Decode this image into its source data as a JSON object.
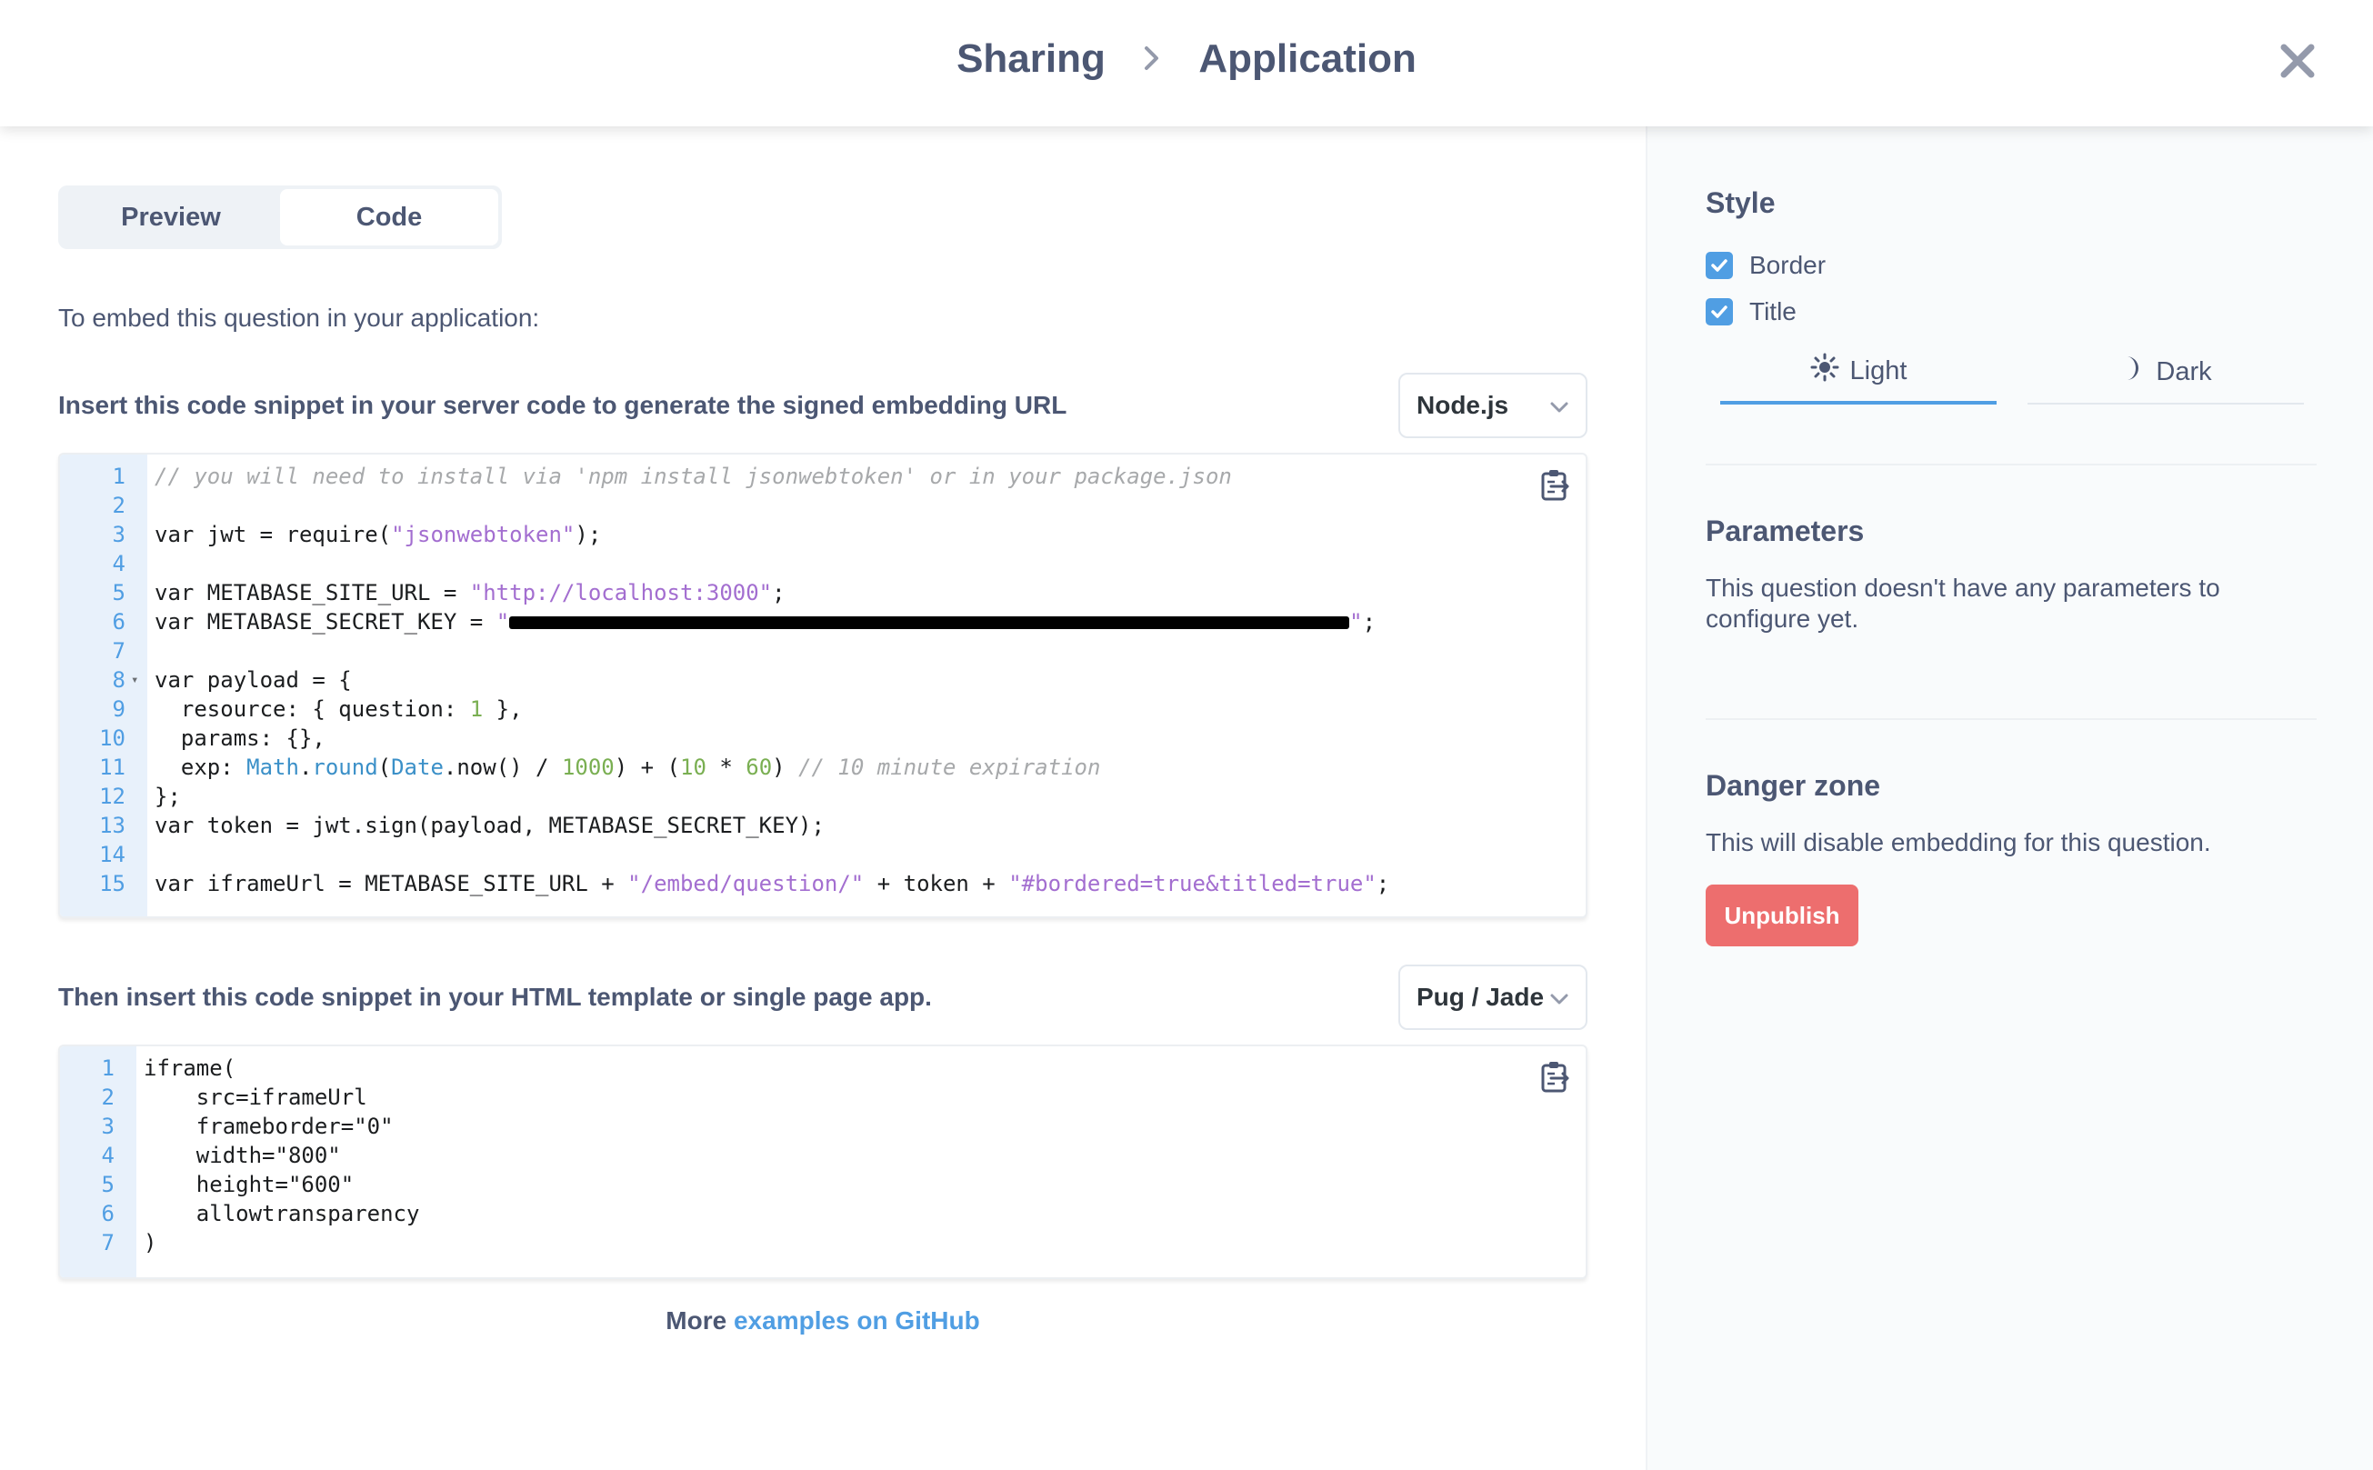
{
  "header": {
    "breadcrumb": [
      "Sharing",
      "Application"
    ]
  },
  "tabs": [
    {
      "label": "Preview",
      "active": false
    },
    {
      "label": "Code",
      "active": true
    }
  ],
  "intro_text": "To embed this question in your application:",
  "server_snippet": {
    "label": "Insert this code snippet in your server code to generate the signed embedding URL",
    "language": "Node.js",
    "line_numbers": [
      "1",
      "2",
      "3",
      "4",
      "5",
      "6",
      "7",
      "8",
      "9",
      "10",
      "11",
      "12",
      "13",
      "14",
      "15"
    ]
  },
  "html_snippet": {
    "label": "Then insert this code snippet in your HTML template or single page app.",
    "language": "Pug / Jade",
    "line_numbers": [
      "1",
      "2",
      "3",
      "4",
      "5",
      "6",
      "7"
    ]
  },
  "code_text": {
    "s_l1": "// you will need to install via 'npm install jsonwebtoken' or in your package.json",
    "s_l3a": "var jwt = require(",
    "s_l3b": "\"jsonwebtoken\"",
    "s_l3c": ");",
    "s_l5a": "var METABASE_SITE_URL = ",
    "s_l5b": "\"http://localhost:3000\"",
    "s_l5c": ";",
    "s_l6a": "var METABASE_SECRET_KEY = ",
    "s_l6b": "\"",
    "s_l6c": "\"",
    "s_l6d": ";",
    "s_l8": "var payload = {",
    "s_l9a": "  resource: { question: ",
    "s_l9b": "1",
    "s_l9c": " },",
    "s_l10": "  params: {},",
    "s_l11a": "  exp: ",
    "s_l11b": "Math",
    "s_l11c": ".",
    "s_l11d": "round",
    "s_l11e": "(",
    "s_l11f": "Date",
    "s_l11g": ".now() / ",
    "s_l11h": "1000",
    "s_l11i": ") + (",
    "s_l11j": "10",
    "s_l11k": " * ",
    "s_l11l": "60",
    "s_l11m": ") ",
    "s_l11n": "// 10 minute expiration",
    "s_l12": "};",
    "s_l13": "var token = jwt.sign(payload, METABASE_SECRET_KEY);",
    "s_l15a": "var iframeUrl = METABASE_SITE_URL + ",
    "s_l15b": "\"/embed/question/\"",
    "s_l15c": " + token + ",
    "s_l15d": "\"#bordered=true&titled=true\"",
    "s_l15e": ";",
    "h_l1": "iframe(",
    "h_l2": "    src=iframeUrl",
    "h_l3": "    frameborder=\"0\"",
    "h_l4": "    width=\"800\"",
    "h_l5": "    height=\"600\"",
    "h_l6": "    allowtransparency",
    "h_l7": ")"
  },
  "footer": {
    "more_prefix": "More",
    "link_text": "examples on GitHub"
  },
  "style_panel": {
    "heading": "Style",
    "options": [
      {
        "label": "Border",
        "checked": true
      },
      {
        "label": "Title",
        "checked": true
      }
    ],
    "themes": [
      {
        "label": "Light",
        "icon": "sun-icon",
        "active": true
      },
      {
        "label": "Dark",
        "icon": "moon-icon",
        "active": false
      }
    ]
  },
  "parameters_panel": {
    "heading": "Parameters",
    "text": "This question doesn't have any parameters to configure yet."
  },
  "danger_panel": {
    "heading": "Danger zone",
    "text": "This will disable embedding for this question.",
    "button_label": "Unpublish"
  },
  "colors": {
    "accent": "#509ee3",
    "danger": "#ed6e6e",
    "text": "#4c5773",
    "gutter": "#e8f1fb"
  }
}
